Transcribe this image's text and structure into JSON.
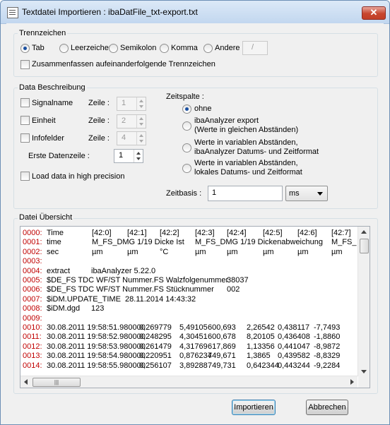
{
  "window": {
    "title": "Textdatei Importieren : ibaDatFile_txt-export.txt",
    "close_label": "✕"
  },
  "trennzeichen": {
    "legend": "Trennzeichen",
    "options": [
      "Tab",
      "Leerzeichen",
      "Semikolon",
      "Komma",
      "Andere"
    ],
    "selected": "Tab",
    "andere_value": "/",
    "zusammenfassen_label": "Zusammenfassen aufeinanderfolgende Trennzeichen",
    "zusammenfassen_checked": false
  },
  "data_beschreibung": {
    "legend": "Data Beschreibung",
    "signalname_label": "Signalname",
    "einheit_label": "Einheit",
    "infofelder_label": "Infofelder",
    "zeile_label": "Zeile :",
    "signalname_zeile": "1",
    "einheit_zeile": "2",
    "infofelder_zeile": "4",
    "erste_datenzeile_label": "Erste Datenzeile :",
    "erste_datenzeile_value": "1",
    "load_precision_label": "Load data in high precision",
    "zeitspalte_label": "Zeitspalte :",
    "zeitspalte_options": [
      {
        "line1": "ohne",
        "line2": ""
      },
      {
        "line1": "ibaAnalyzer export",
        "line2": "(Werte in gleichen Abständen)"
      },
      {
        "line1": "Werte in variablen Abständen,",
        "line2": "ibaAnalyzer Datums- und Zeitformat"
      },
      {
        "line1": "Werte in variablen Abständen,",
        "line2": "lokales Datums- und Zeitformat"
      }
    ],
    "zeitspalte_selected": "ohne",
    "zeitbasis_label": "Zeitbasis :",
    "zeitbasis_value": "1",
    "zeitbasis_unit": "ms"
  },
  "datei_uebersicht": {
    "legend": "Datei Übersicht",
    "lines": [
      {
        "num": "0000:",
        "cells": [
          "Time",
          "[42:0]",
          "[42:1]",
          "[42:2]",
          "[42:3]",
          "[42:4]",
          "[42:5]",
          "[42:6]",
          "[42:7]"
        ]
      },
      {
        "num": "0001:",
        "cells": [
          "time",
          "M_FS_DMG 1/19 Dicke Ist",
          "",
          "",
          "M_FS_DMG 1/19 Dickenabweichung",
          "",
          "",
          "",
          "M_FS_"
        ]
      },
      {
        "num": "0002:",
        "cells": [
          "sec",
          "µm",
          "µm",
          "°C",
          "µm",
          "µm",
          "µm",
          "µm",
          "µm"
        ]
      },
      {
        "num": "0003:",
        "cells": []
      },
      {
        "num": "0004:",
        "cells": [
          "extract",
          "ibaAnalyzer 5.22.0"
        ]
      },
      {
        "num": "0005:",
        "cells": [
          "$DE_FS TDC WF/ST Nummer.FS Walzfolgenummer",
          "38037"
        ]
      },
      {
        "num": "0006:",
        "cells": [
          "$DE_FS TDC WF/ST Nummer.FS Stücknummer",
          "002"
        ]
      },
      {
        "num": "0007:",
        "cells": [
          "$iDM.UPDATE_TIME",
          "28.11.2014 14:43:32"
        ]
      },
      {
        "num": "0008:",
        "cells": [
          "$iDM.dgd",
          "123"
        ]
      },
      {
        "num": "0009:",
        "cells": []
      },
      {
        "num": "0010:",
        "cells": [
          "30.08.2011 19:58:51.980000",
          "0,269779",
          "5,49105",
          "600,693",
          "2,26542",
          "0,438117",
          "-7,7493"
        ]
      },
      {
        "num": "0011:",
        "cells": [
          "30.08.2011 19:58:52.980000",
          "0,248295",
          "4,30451",
          "600,678",
          "8,20105",
          "0,436408",
          "-1,8860"
        ]
      },
      {
        "num": "0012:",
        "cells": [
          "30.08.2011 19:58:53.980000",
          "0,261479",
          "4,31769",
          "617,869",
          "1,13356",
          "0,441047",
          "-8,9872"
        ]
      },
      {
        "num": "0013:",
        "cells": [
          "30.08.2011 19:58:54.980000",
          "0,220951",
          "0,876234",
          "749,671",
          "1,3865",
          "0,439582",
          "-8,8329"
        ]
      },
      {
        "num": "0014:",
        "cells": [
          "30.08.2011 19:58:55.980000",
          "0,256107",
          "3,89288",
          "749,731",
          "0,642344",
          "0,443244",
          "-9,2284"
        ]
      }
    ],
    "hscroll_thumb": "|||"
  },
  "buttons": {
    "import_label": "Importieren",
    "cancel_label": "Abbrechen"
  },
  "colors": {
    "line_number": "#c00000",
    "accent": "#3c7fb1"
  }
}
